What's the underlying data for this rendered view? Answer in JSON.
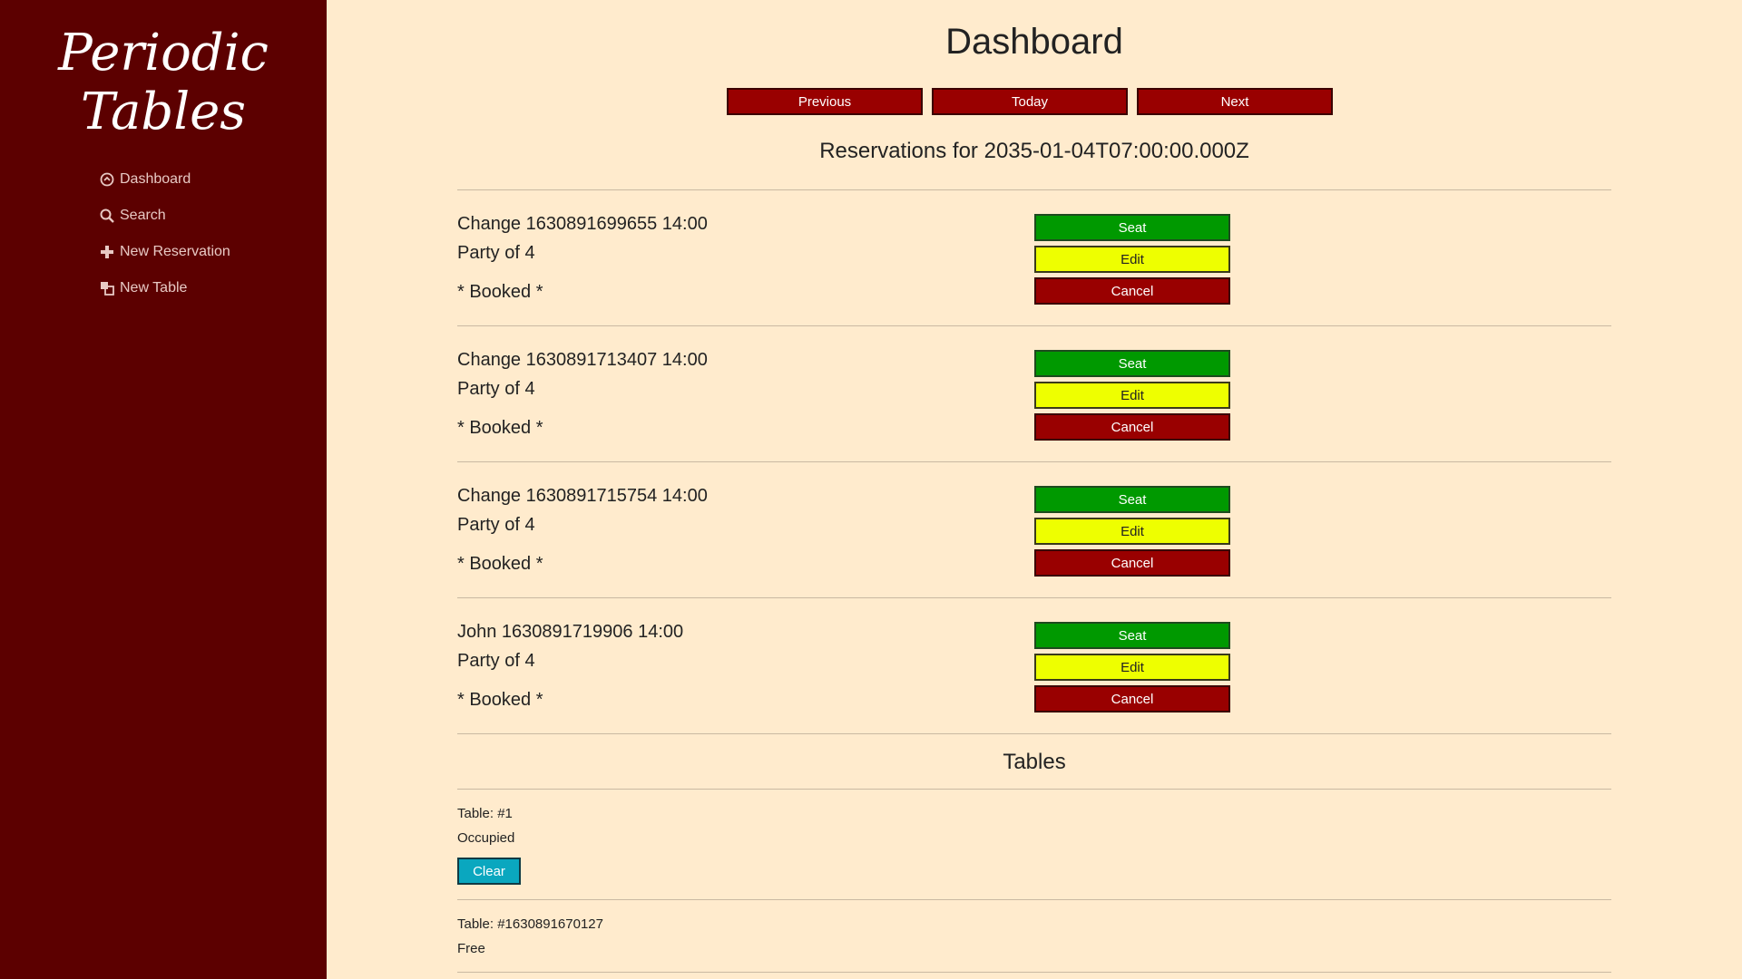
{
  "sidebar": {
    "brand": "Periodic Tables",
    "items": [
      {
        "label": "Dashboard",
        "icon": "dashboard-icon"
      },
      {
        "label": "Search",
        "icon": "search-icon"
      },
      {
        "label": "New Reservation",
        "icon": "plus-icon"
      },
      {
        "label": "New Table",
        "icon": "table-icon"
      }
    ]
  },
  "header": {
    "title": "Dashboard",
    "previous_label": "Previous",
    "today_label": "Today",
    "next_label": "Next",
    "reservations_heading": "Reservations for 2035-01-04T07:00:00.000Z"
  },
  "reservations": [
    {
      "name": "Change 1630891699655 14:00",
      "party": "Party of 4",
      "status": "* Booked *",
      "seat": "Seat",
      "edit": "Edit",
      "cancel": "Cancel"
    },
    {
      "name": "Change 1630891713407 14:00",
      "party": "Party of 4",
      "status": "* Booked *",
      "seat": "Seat",
      "edit": "Edit",
      "cancel": "Cancel"
    },
    {
      "name": "Change 1630891715754 14:00",
      "party": "Party of 4",
      "status": "* Booked *",
      "seat": "Seat",
      "edit": "Edit",
      "cancel": "Cancel"
    },
    {
      "name": "John 1630891719906 14:00",
      "party": "Party of 4",
      "status": "* Booked *",
      "seat": "Seat",
      "edit": "Edit",
      "cancel": "Cancel"
    }
  ],
  "tables_heading": "Tables",
  "tables": [
    {
      "name": "Table: #1",
      "status": "Occupied",
      "clear": "Clear"
    },
    {
      "name": "Table: #1630891670127",
      "status": "Free"
    }
  ],
  "colors": {
    "sidebar": "#5c0000",
    "background": "#ffebcd",
    "red": "#990000",
    "green": "#009900",
    "yellow": "#eeff00",
    "cyan": "#0aa7bf"
  }
}
